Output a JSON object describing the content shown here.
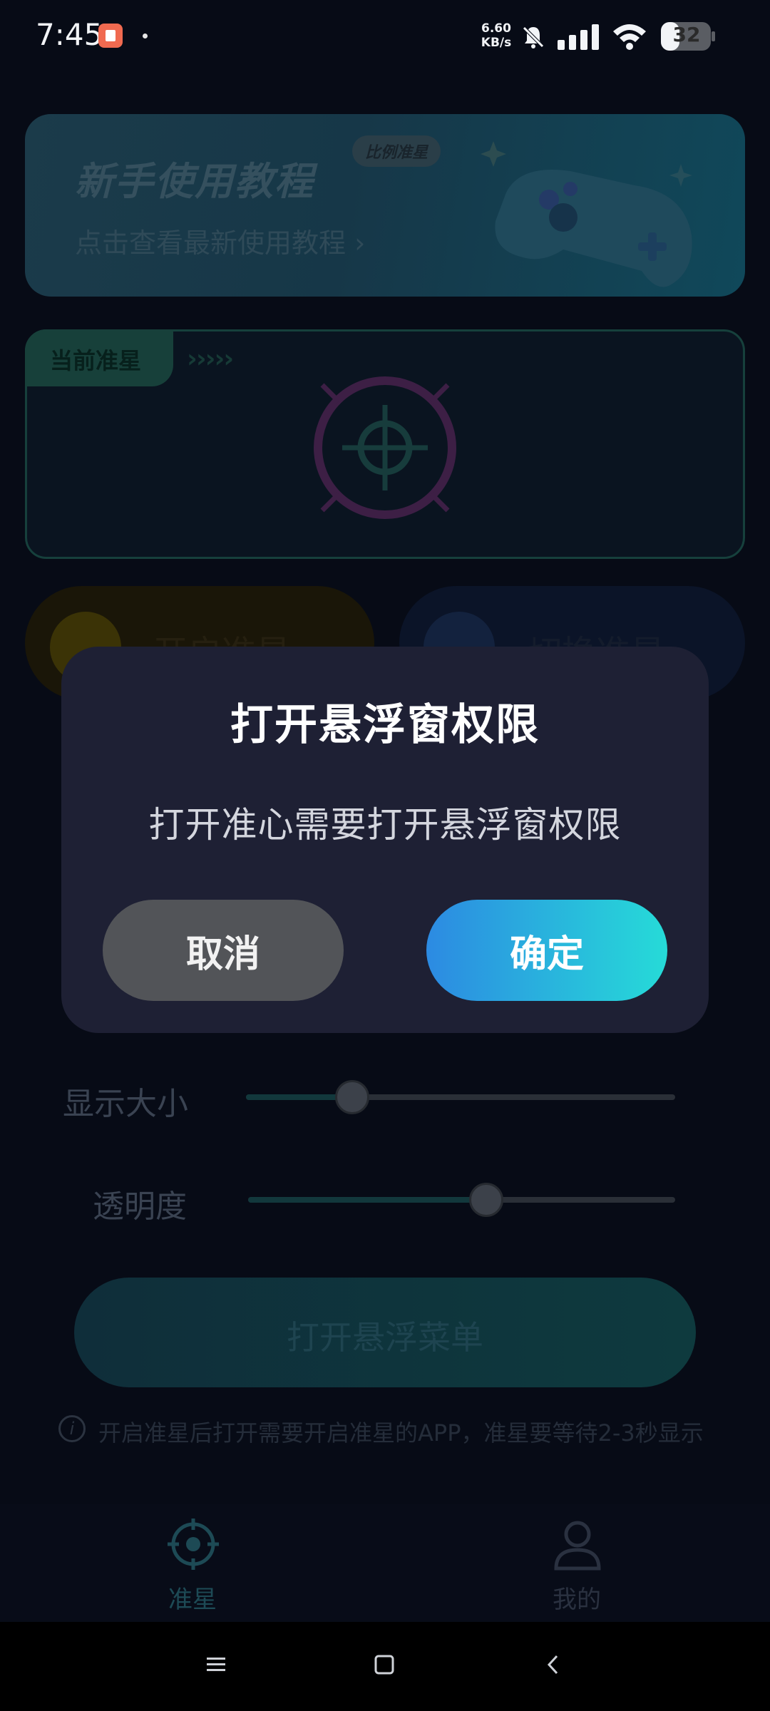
{
  "status_bar": {
    "time": "7:45",
    "net_speed_value": "6.60",
    "net_speed_unit": "KB/s",
    "battery": "32",
    "icons": [
      "notification-app-icon",
      "bell-muted-icon",
      "signal-icon",
      "wifi-icon",
      "battery-icon"
    ]
  },
  "banner": {
    "title": "新手使用教程",
    "subtitle": "点击查看最新使用教程 ›",
    "chip": "比例准星"
  },
  "aim_card": {
    "tab_label": "当前准星",
    "chevrons": "›››››"
  },
  "actions": {
    "open_label": "开启准星",
    "switch_label": "切换准星"
  },
  "sliders": {
    "size_label": "显示大小",
    "size_value": 0.25,
    "opacity_label": "透明度",
    "opacity_value": 0.56
  },
  "menu_button": {
    "label": "打开悬浮菜单"
  },
  "info": {
    "text": "开启准星后打开需要开启准星的APP，准星要等待2-3秒显示"
  },
  "tabbar": {
    "items": [
      {
        "label": "准星",
        "active": true
      },
      {
        "label": "我的",
        "active": false
      }
    ]
  },
  "dialog": {
    "title": "打开悬浮窗权限",
    "message": "打开准心需要打开悬浮窗权限",
    "cancel_label": "取消",
    "confirm_label": "确定"
  },
  "colors": {
    "dialog_bg": "#1e2034",
    "confirm_gradient_start": "#2c8ae2",
    "confirm_gradient_end": "#26dbd8",
    "cancel_bg": "#525458"
  }
}
